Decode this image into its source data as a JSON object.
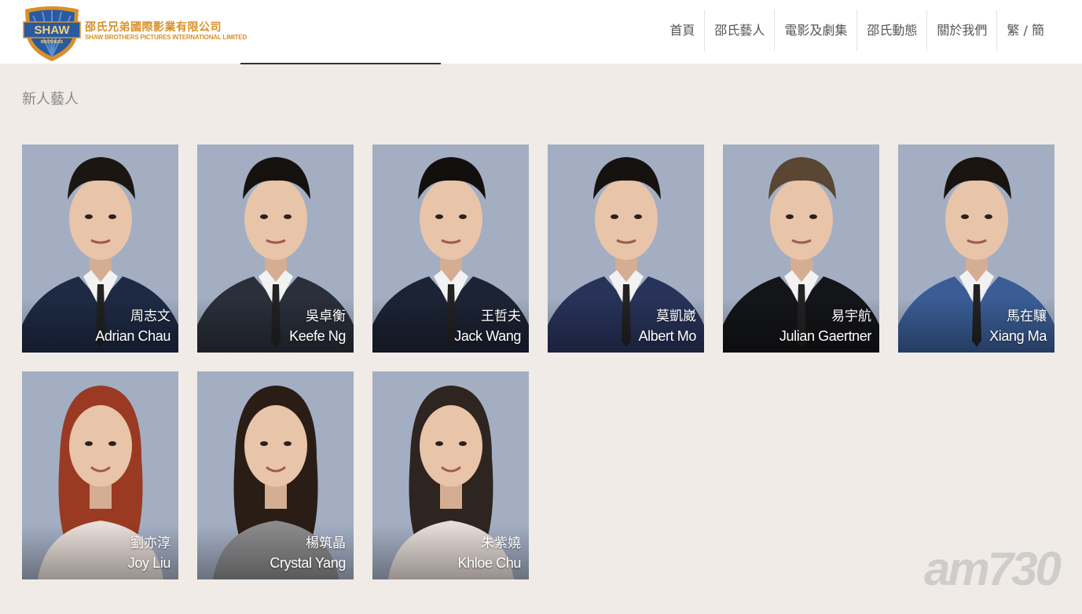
{
  "header": {
    "logo_badge": "SHAW",
    "logo_badge_sub": "BROTHERS",
    "logo_cn": "邵氏兄弟國際影業有限公司",
    "logo_en": "SHAW BROTHERS PICTURES INTERNATIONAL LIMITED",
    "nav": [
      "首頁",
      "邵氏藝人",
      "電影及劇集",
      "邵氏動態",
      "關於我們",
      "繁 / 簡"
    ]
  },
  "section_title": "新人藝人",
  "artists": [
    {
      "cn": "周志文",
      "en": "Adrian Chau",
      "gender": "male",
      "suit": "#1e2a44",
      "hair": "#1c1612"
    },
    {
      "cn": "吳卓衡",
      "en": "Keefe Ng",
      "gender": "male",
      "suit": "#2a2f3a",
      "hair": "#15110e"
    },
    {
      "cn": "王哲夫",
      "en": "Jack Wang",
      "gender": "male",
      "suit": "#1c2334",
      "hair": "#120f0d"
    },
    {
      "cn": "莫凱崴",
      "en": "Albert Mo",
      "gender": "male",
      "suit": "#28335a",
      "hair": "#16120f"
    },
    {
      "cn": "易宇航",
      "en": "Julian Gaertner",
      "gender": "male",
      "suit": "#141518",
      "hair": "#5a4632"
    },
    {
      "cn": "馬在驤",
      "en": "Xiang Ma",
      "gender": "male",
      "suit": "#3a5d96",
      "hair": "#1a1410"
    },
    {
      "cn": "劉亦淳",
      "en": "Joy Liu",
      "gender": "female",
      "suit": "#e8ddd8",
      "hair": "#9a3a22"
    },
    {
      "cn": "楊筑晶",
      "en": "Crystal Yang",
      "gender": "female",
      "suit": "#8a8a8c",
      "hair": "#2a1d16"
    },
    {
      "cn": "朱紫嬈",
      "en": "Khloe Chu",
      "gender": "female",
      "suit": "#e6dcd8",
      "hair": "#2e2420"
    }
  ],
  "watermark": "am730",
  "colors": {
    "background": "#f0ebe6",
    "photo_backdrop": "#a3aec3",
    "logo_gold": "#d9902a",
    "logo_blue": "#2a5aa0"
  }
}
